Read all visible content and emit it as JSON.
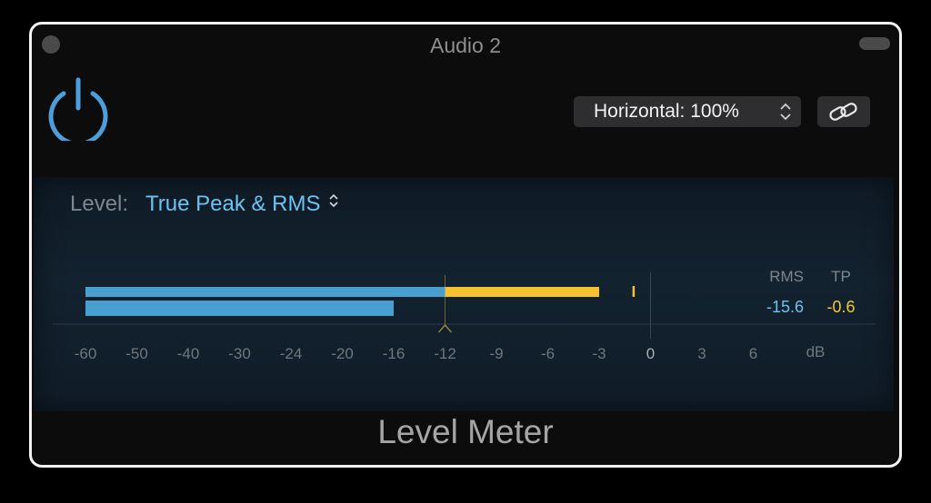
{
  "window": {
    "title": "Audio 2"
  },
  "header": {
    "horizontal_label": "Horizontal: 100%"
  },
  "meter": {
    "level_label": "Level:",
    "level_mode": "True Peak & RMS",
    "columns": {
      "rms_header": "RMS",
      "tp_header": "TP"
    },
    "readouts": {
      "rms": "-15.6",
      "tp": "-0.6"
    },
    "scale_ticks": [
      "-60",
      "-50",
      "-40",
      "-30",
      "-24",
      "-20",
      "-16",
      "-12",
      "-9",
      "-6",
      "-3",
      "0",
      "3",
      "6"
    ],
    "unit": "dB",
    "target_db": -12,
    "bars": {
      "true_peak_db": -3,
      "rms_db": -16,
      "peak_hold_db": -1
    },
    "colors": {
      "rms": "#4a9fd1",
      "over_target": "#f5c330",
      "accent": "#6cc2f0"
    }
  },
  "footer": {
    "plugin_name": "Level Meter"
  }
}
